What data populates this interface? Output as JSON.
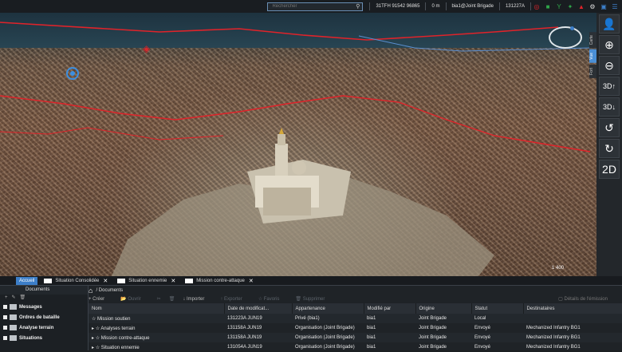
{
  "topbar": {
    "search_placeholder": "Rechercher",
    "coordinates": "31TFH 91542 96865",
    "altitude": "0 m",
    "user": "bia1@Joint Brigade",
    "time": "131227A"
  },
  "map": {
    "scale": "1 400",
    "side_tabs": [
      "Carte",
      "Vue",
      "Fort",
      "Ca"
    ],
    "right_buttons": [
      "person-icon",
      "zoom-in-icon",
      "zoom-out-icon",
      "rotate-3d-up-icon",
      "rotate-3d-down-icon",
      "rotate-left-icon",
      "rotate-right-icon",
      "2D"
    ]
  },
  "tabs": [
    {
      "label": "Accueil",
      "active": true
    },
    {
      "label": "Situation Consolidée"
    },
    {
      "label": "Situation ennemie"
    },
    {
      "label": "Mission contre-attaque"
    }
  ],
  "tree": {
    "header": "Documents",
    "items": [
      "Messages",
      "Ordres de bataille",
      "Analyse terrain",
      "Situations"
    ]
  },
  "documents": {
    "breadcrumb": "Documents",
    "toolbar": {
      "create": "Créer",
      "open": "Ouvrir",
      "import": "Importer",
      "export": "Exporter",
      "favorite": "Favoris",
      "delete": "Supprimer",
      "emission_detail": "Détails de l'émission"
    },
    "columns": [
      "Nom",
      "Date de modificat...",
      "Appartenance",
      "Modifié par",
      "Origine",
      "Statut",
      "Destinataires"
    ],
    "rows": [
      [
        "Mission soutien",
        "131223A JUN19",
        "Privé (bia1)",
        "bia1",
        "Joint Brigade",
        "Local",
        ""
      ],
      [
        "Analyses terrain",
        "131158A JUN19",
        "Organisation (Joint Brigade)",
        "bia1",
        "Joint Brigade",
        "Envoyé",
        "Mechanized Infantry BG1"
      ],
      [
        "Mission contre-attaque",
        "131158A JUN19",
        "Organisation (Joint Brigade)",
        "bia1",
        "Joint Brigade",
        "Envoyé",
        "Mechanized Infantry BG1"
      ],
      [
        "Situation ennemie",
        "131054A JUN19",
        "Organisation (Joint Brigade)",
        "bia1",
        "Joint Brigade",
        "Envoyé",
        "Mechanized Infantry BG1"
      ]
    ]
  }
}
